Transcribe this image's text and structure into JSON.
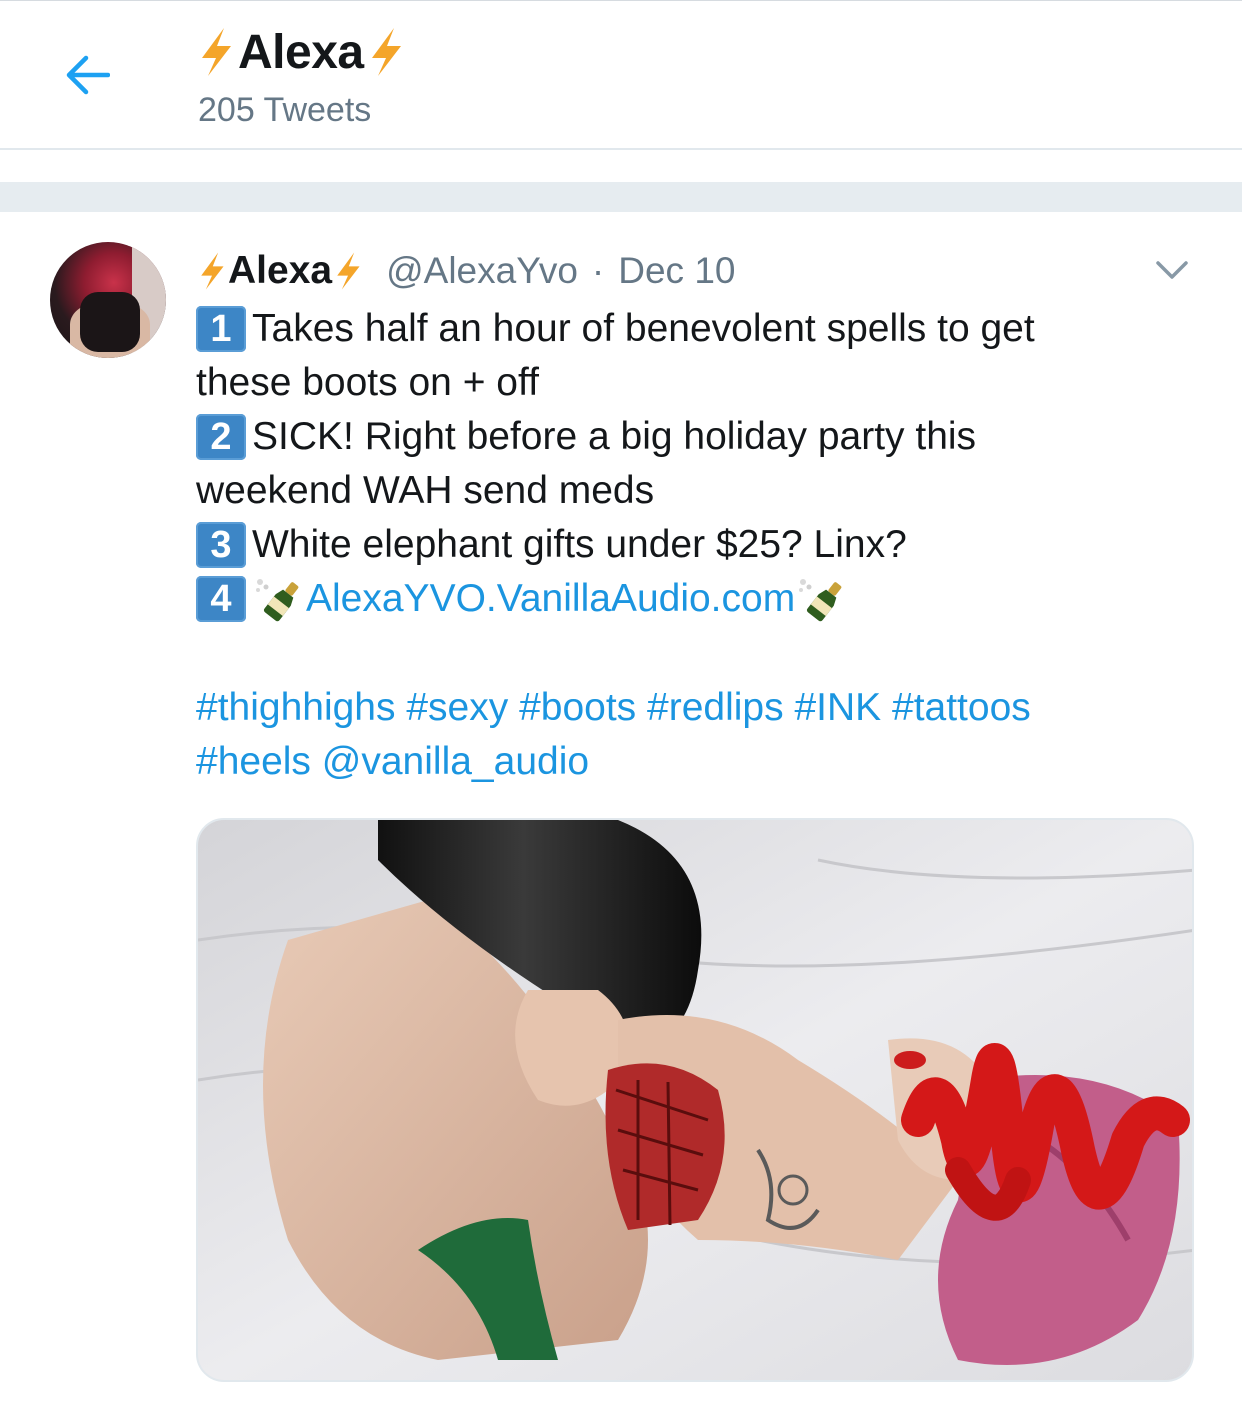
{
  "header": {
    "title": "Alexa",
    "tweet_count": "205 Tweets",
    "accent": "#1da1f2",
    "bolt_color": "#f4a52a"
  },
  "tweet": {
    "display_name": "Alexa",
    "handle": "@AlexaYvo",
    "separator": "·",
    "date": "Dec 10",
    "lines": [
      {
        "key": "1",
        "text": "Takes half an hour of benevolent spells to get"
      },
      {
        "text": "these boots on + off"
      },
      {
        "key": "2",
        "text": "SICK! Right before a big holiday party this"
      },
      {
        "text": "weekend WAH send meds"
      },
      {
        "key": "3",
        "text": "White elephant gifts under $25? Linx?"
      }
    ],
    "link_line": {
      "key": "4",
      "url_text": "AlexaYVO.VanillaAudio.com"
    },
    "hashtags_line1": [
      "#thighhighs",
      "#sexy",
      "#boots",
      "#redlips",
      "#INK",
      "#tattoos"
    ],
    "hashtags_line2": [
      "#heels",
      "@vanilla_audio"
    ],
    "link_color": "#1b95e0"
  }
}
